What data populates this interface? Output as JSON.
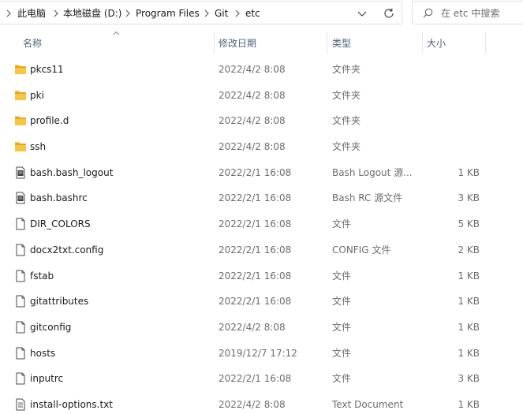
{
  "address_bar": {
    "breadcrumbs": [
      "此电脑",
      "本地磁盘 (D:)",
      "Program Files",
      "Git",
      "etc"
    ]
  },
  "search": {
    "placeholder": "在 etc 中搜索"
  },
  "columns": {
    "name": "名称",
    "date": "修改日期",
    "type": "类型",
    "size": "大小"
  },
  "files": [
    {
      "name": "pkcs11",
      "date": "2022/4/2 8:08",
      "type": "文件夹",
      "size": "",
      "icon": "folder-icon"
    },
    {
      "name": "pki",
      "date": "2022/4/2 8:08",
      "type": "文件夹",
      "size": "",
      "icon": "folder-icon"
    },
    {
      "name": "profile.d",
      "date": "2022/4/2 8:08",
      "type": "文件夹",
      "size": "",
      "icon": "folder-icon"
    },
    {
      "name": "ssh",
      "date": "2022/4/2 8:08",
      "type": "文件夹",
      "size": "",
      "icon": "folder-icon"
    },
    {
      "name": "bash.bash_logout",
      "date": "2022/2/1 16:08",
      "type": "Bash Logout 源...",
      "size": "1 KB",
      "icon": "script-file-icon"
    },
    {
      "name": "bash.bashrc",
      "date": "2022/2/1 16:08",
      "type": "Bash RC 源文件",
      "size": "3 KB",
      "icon": "script-file-icon"
    },
    {
      "name": "DIR_COLORS",
      "date": "2022/2/1 16:08",
      "type": "文件",
      "size": "5 KB",
      "icon": "file-icon"
    },
    {
      "name": "docx2txt.config",
      "date": "2022/2/1 16:08",
      "type": "CONFIG 文件",
      "size": "2 KB",
      "icon": "file-icon"
    },
    {
      "name": "fstab",
      "date": "2022/2/1 16:08",
      "type": "文件",
      "size": "1 KB",
      "icon": "file-icon"
    },
    {
      "name": "gitattributes",
      "date": "2022/2/1 16:08",
      "type": "文件",
      "size": "1 KB",
      "icon": "file-icon"
    },
    {
      "name": "gitconfig",
      "date": "2022/4/2 8:08",
      "type": "文件",
      "size": "1 KB",
      "icon": "file-icon"
    },
    {
      "name": "hosts",
      "date": "2019/12/7 17:12",
      "type": "文件",
      "size": "1 KB",
      "icon": "file-icon"
    },
    {
      "name": "inputrc",
      "date": "2022/2/1 16:08",
      "type": "文件",
      "size": "3 KB",
      "icon": "file-icon"
    },
    {
      "name": "install-options.txt",
      "date": "2022/4/2 8:08",
      "type": "Text Document",
      "size": "1 KB",
      "icon": "text-file-icon"
    }
  ],
  "colors": {
    "folder": "#f8c541",
    "folder_dark": "#e6a91e",
    "header_text": "#4c607a",
    "secondary_text": "#6d6d6d",
    "border": "#e0e0e0"
  }
}
